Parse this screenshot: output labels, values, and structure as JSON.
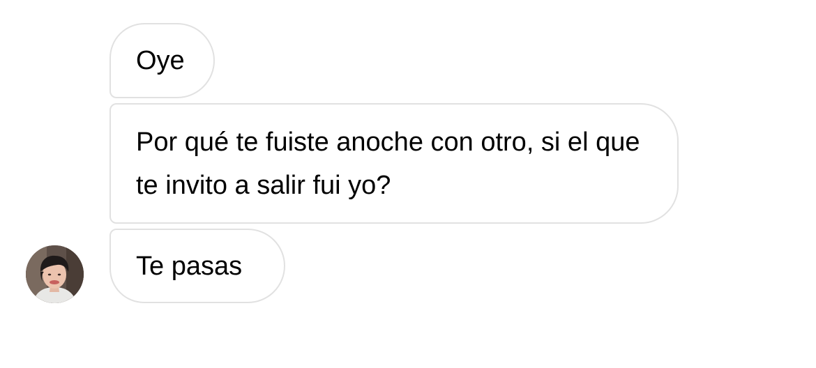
{
  "conversation": {
    "messages": [
      {
        "text": "Oye"
      },
      {
        "text": "Por qué te fuiste anoche con otro, si el que te invito a salir fui yo?"
      },
      {
        "text": "Te pasas"
      }
    ],
    "sender": {
      "avatar_icon": "avatar-photo"
    }
  },
  "colors": {
    "background": "#ffffff",
    "bubble_background": "#ffffff",
    "bubble_border": "#e1e1e1",
    "text": "#000000"
  }
}
